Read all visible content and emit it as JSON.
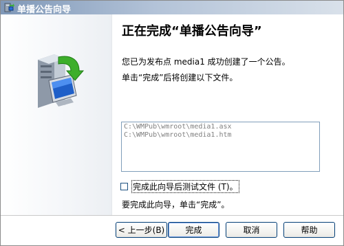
{
  "window": {
    "title": "单播公告向导"
  },
  "page": {
    "heading": "正在完成“单播公告向导”",
    "line1": "您已为发布点 media1 成功创建了一个公告。",
    "line2": "单击“完成”后将创建以下文件。",
    "files": [
      "C:\\WMPub\\wmroot\\media1.asx",
      "C:\\WMPub\\wmroot\\media1.htm"
    ],
    "checkbox_label": "完成此向导后测试文件 (T)。",
    "finish_instruction": "要完成此向导，单击“完成”。"
  },
  "buttons": {
    "back": "< 上一步(B)",
    "finish": "完成",
    "cancel": "取消",
    "help": "帮助"
  },
  "colors": {
    "titlebar": "#7f98b8",
    "button_border": "#003c74",
    "file_text": "#808080"
  },
  "icons": {
    "app": "server-wizard-icon",
    "hero": "server-arrow-icon"
  }
}
